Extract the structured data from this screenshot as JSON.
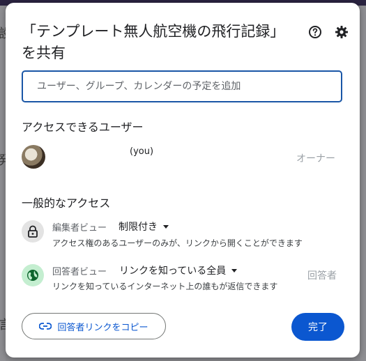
{
  "dialog": {
    "title": "「テンプレート無人航空機の飛行記録」を共有",
    "help_icon": "help-circle-icon",
    "settings_icon": "gear-icon"
  },
  "search": {
    "placeholder": "ユーザー、グループ、カレンダーの予定を追加"
  },
  "users_section": {
    "title": "アクセスできるユーザー",
    "users": [
      {
        "you_label": "(you)",
        "role": "オーナー"
      }
    ]
  },
  "general_access": {
    "title": "一般的なアクセス",
    "editor": {
      "role_label": "編集者ビュー",
      "setting": "制限付き",
      "description": "アクセス権のあるユーザーのみが、リンクから開くことができます",
      "icon": "lock-icon"
    },
    "responder": {
      "role_label": "回答者ビュー",
      "setting": "リンクを知っている全員",
      "description": "リンクを知っているインターネット上の誰もが返信できます",
      "right_role": "回答者",
      "icon": "globe-icon"
    }
  },
  "footer": {
    "copy_link_label": "回答者リンクをコピー",
    "done_label": "完了"
  },
  "colors": {
    "accent": "#0b57d0",
    "search_border": "#1a56a6",
    "globe_bg": "#c4eed0",
    "lock_bg": "#e3e3e3"
  },
  "background": {
    "glyphs": [
      "設",
      "発",
      "言"
    ]
  }
}
